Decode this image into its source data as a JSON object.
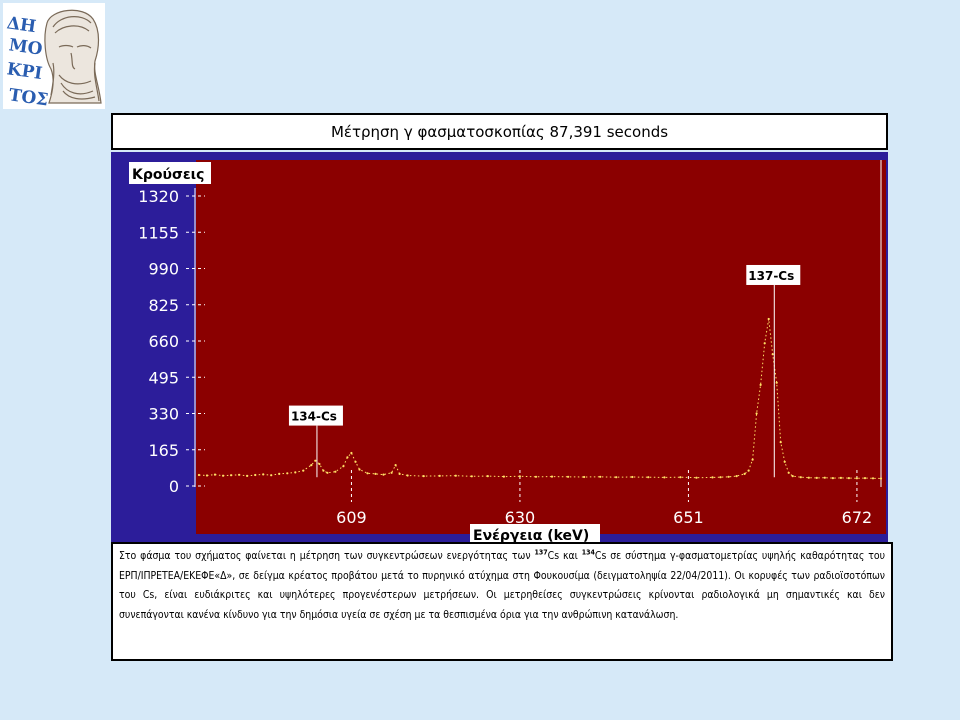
{
  "logo": {
    "lettering": "ΔΗΜΟΚΡΙΤΟΣ",
    "icon": "democritus-bust-icon",
    "color": "#2a5db0"
  },
  "header": {
    "title": "Μέτρηση γ φασματοσκοπίας 87,391 seconds"
  },
  "chart_data": {
    "type": "line",
    "title": "Μέτρηση γ φασματοσκοπίας 87,391 seconds",
    "xlabel": "Ενέργεια (keV)",
    "ylabel": "Κρούσεις",
    "xlim": [
      590,
      675
    ],
    "ylim": [
      0,
      1320
    ],
    "xticks": [
      609,
      630,
      651,
      672
    ],
    "xtick_labels": [
      "609",
      "630",
      "651",
      "672"
    ],
    "yticks": [
      0,
      165,
      330,
      495,
      660,
      825,
      990,
      1155,
      1320
    ],
    "ytick_labels": [
      "0",
      "165",
      "330",
      "495",
      "660",
      "825",
      "990",
      "1155",
      "1320"
    ],
    "grid": false,
    "colors": {
      "panel": "#2c1d9a",
      "plot_area": "#8b0000",
      "data": "#ffe066",
      "axis_text": "#ffffff"
    },
    "annotations": [
      {
        "label": "134-Cs",
        "x": 604.7,
        "y": 275
      },
      {
        "label": "137-Cs",
        "x": 661.7,
        "y": 915
      }
    ],
    "series": [
      {
        "points": [
          [
            590,
            50
          ],
          [
            591,
            48
          ],
          [
            592,
            52
          ],
          [
            593,
            47
          ],
          [
            594,
            49
          ],
          [
            595,
            51
          ],
          [
            596,
            46
          ],
          [
            597,
            50
          ],
          [
            598,
            53
          ],
          [
            599,
            49
          ],
          [
            600,
            55
          ],
          [
            601,
            58
          ],
          [
            602,
            62
          ],
          [
            603,
            70
          ],
          [
            604,
            95
          ],
          [
            604.5,
            115
          ],
          [
            605,
            100
          ],
          [
            605.5,
            70
          ],
          [
            606,
            60
          ],
          [
            607,
            65
          ],
          [
            608,
            90
          ],
          [
            608.5,
            130
          ],
          [
            609,
            150
          ],
          [
            609.5,
            110
          ],
          [
            610,
            75
          ],
          [
            611,
            58
          ],
          [
            612,
            55
          ],
          [
            613,
            52
          ],
          [
            614,
            60
          ],
          [
            614.5,
            95
          ],
          [
            615,
            55
          ],
          [
            616,
            48
          ],
          [
            618,
            45
          ],
          [
            620,
            46
          ],
          [
            622,
            47
          ],
          [
            624,
            44
          ],
          [
            626,
            45
          ],
          [
            628,
            43
          ],
          [
            630,
            44
          ],
          [
            632,
            42
          ],
          [
            634,
            43
          ],
          [
            636,
            42
          ],
          [
            638,
            41
          ],
          [
            640,
            42
          ],
          [
            642,
            40
          ],
          [
            644,
            41
          ],
          [
            646,
            40
          ],
          [
            648,
            39
          ],
          [
            650,
            40
          ],
          [
            652,
            38
          ],
          [
            654,
            39
          ],
          [
            655,
            40
          ],
          [
            656,
            42
          ],
          [
            657,
            45
          ],
          [
            658,
            55
          ],
          [
            658.5,
            70
          ],
          [
            659,
            120
          ],
          [
            659.5,
            330
          ],
          [
            660,
            460
          ],
          [
            660.5,
            650
          ],
          [
            661,
            760
          ],
          [
            661.5,
            600
          ],
          [
            662,
            470
          ],
          [
            662.5,
            200
          ],
          [
            663,
            110
          ],
          [
            663.5,
            60
          ],
          [
            664,
            45
          ],
          [
            665,
            40
          ],
          [
            666,
            38
          ],
          [
            667,
            37
          ],
          [
            668,
            38
          ],
          [
            669,
            36
          ],
          [
            670,
            37
          ],
          [
            671,
            36
          ],
          [
            672,
            35
          ],
          [
            673,
            36
          ],
          [
            674,
            35
          ],
          [
            675,
            34
          ]
        ]
      }
    ]
  },
  "caption": {
    "part1": "Στο φάσμα του σχήματος φαίνεται η μέτρηση των συγκεντρώσεων ενεργότητας των ",
    "sup1": "137",
    "iso1": "Cs και ",
    "sup2": "134",
    "iso2": "Cs σε σύστημα γ-φασματομετρίας υψηλής καθαρότητας του ΕΡΠ/ΙΠΡΕΤΕΑ/ΕΚΕΦΕ«Δ», σε δείγμα κρέατος προβάτου μετά το πυρηνικό ατύχημα στη Φουκουσίμα (δειγματοληψία 22/04/2011). Οι κορυφές των ραδιοϊσοτόπων του Cs, είναι ευδιάκριτες και υψηλότερες προγενέστερων μετρήσεων. Οι μετρηθείσες συγκεντρώσεις κρίνονται ραδιολογικά μη σημαντικές και δεν συνεπάγονται κανένα κίνδυνο για την δημόσια υγεία σε σχέση με τα θεσπισμένα όρια για την ανθρώπινη κατανάλωση."
  }
}
